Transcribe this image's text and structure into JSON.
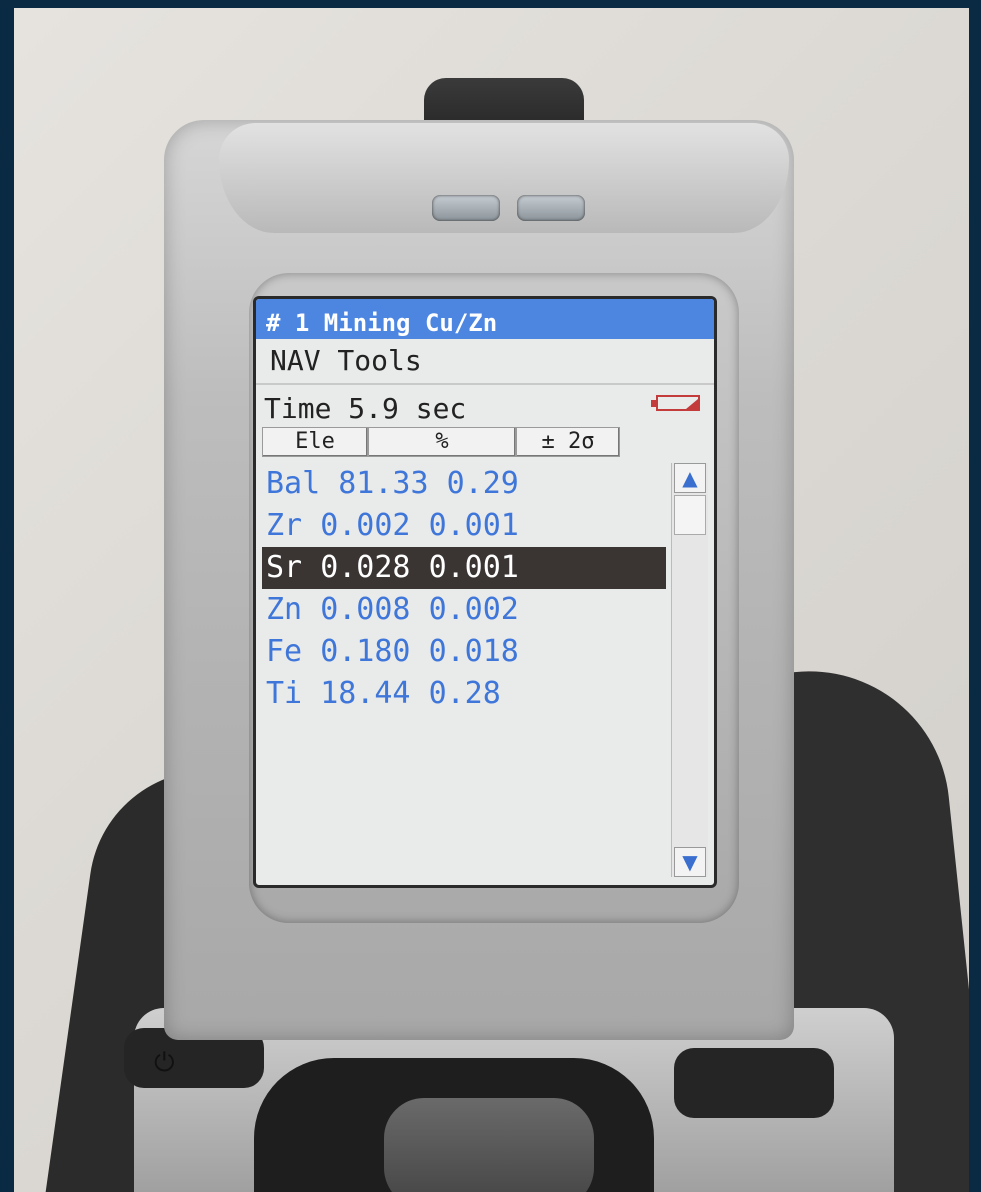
{
  "screen": {
    "title": "# 1 Mining Cu/Zn",
    "menu": "NAV Tools",
    "time_label": "Time 5.9 sec",
    "battery_icon": "battery-low-icon",
    "columns": [
      "Ele",
      "%",
      "± 2σ"
    ],
    "rows": [
      {
        "element": "Bal",
        "percent": "81.33",
        "error": "0.29"
      },
      {
        "element": "Zr",
        "percent": "0.002",
        "error": "0.001"
      },
      {
        "element": "Sr",
        "percent": "0.028",
        "error": "0.001"
      },
      {
        "element": "Zn",
        "percent": "0.008",
        "error": "0.002"
      },
      {
        "element": "Fe",
        "percent": "0.180",
        "error": "0.018"
      },
      {
        "element": "Ti",
        "percent": "18.44",
        "error": "0.28"
      }
    ],
    "selected_row": 2,
    "scroll_up": "▲",
    "scroll_down": "▼"
  },
  "colors": {
    "title_bar": "#4d86e0",
    "row_text": "#3f76d9",
    "selected_bg": "#3a3533",
    "battery": "#c43b3b"
  },
  "device": {
    "power_icon": "power-icon"
  }
}
